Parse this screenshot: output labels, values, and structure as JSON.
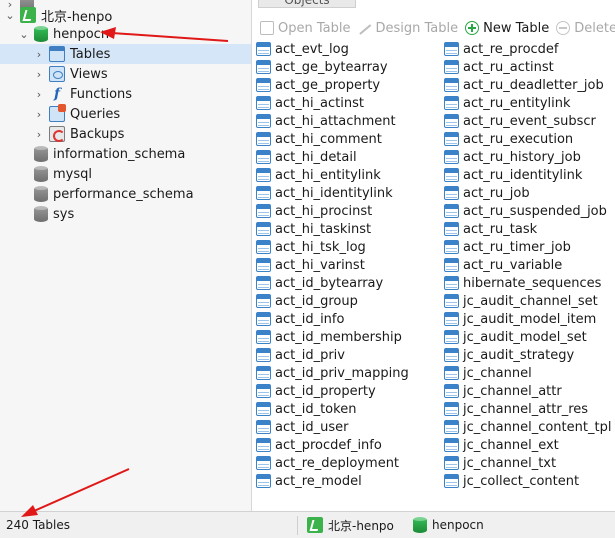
{
  "sidebar": {
    "connection": "北京-henpo",
    "database": "henpocn",
    "categories": {
      "tables": "Tables",
      "views": "Views",
      "functions": "Functions",
      "queries": "Queries",
      "backups": "Backups"
    },
    "other_databases": [
      "information_schema",
      "mysql",
      "performance_schema",
      "sys"
    ]
  },
  "objects_tab": "Objects",
  "toolbar": {
    "open_table": "Open Table",
    "design_table": "Design Table",
    "new_table": "New Table",
    "delete": "Delete"
  },
  "tables": {
    "left": [
      "act_evt_log",
      "act_ge_bytearray",
      "act_ge_property",
      "act_hi_actinst",
      "act_hi_attachment",
      "act_hi_comment",
      "act_hi_detail",
      "act_hi_entitylink",
      "act_hi_identitylink",
      "act_hi_procinst",
      "act_hi_taskinst",
      "act_hi_tsk_log",
      "act_hi_varinst",
      "act_id_bytearray",
      "act_id_group",
      "act_id_info",
      "act_id_membership",
      "act_id_priv",
      "act_id_priv_mapping",
      "act_id_property",
      "act_id_token",
      "act_id_user",
      "act_procdef_info",
      "act_re_deployment",
      "act_re_model"
    ],
    "right": [
      "act_re_procdef",
      "act_ru_actinst",
      "act_ru_deadletter_job",
      "act_ru_entitylink",
      "act_ru_event_subscr",
      "act_ru_execution",
      "act_ru_history_job",
      "act_ru_identitylink",
      "act_ru_job",
      "act_ru_suspended_job",
      "act_ru_task",
      "act_ru_timer_job",
      "act_ru_variable",
      "hibernate_sequences",
      "jc_audit_channel_set",
      "jc_audit_model_item",
      "jc_audit_model_set",
      "jc_audit_strategy",
      "jc_channel",
      "jc_channel_attr",
      "jc_channel_attr_res",
      "jc_channel_content_tpl",
      "jc_channel_ext",
      "jc_channel_txt",
      "jc_collect_content"
    ]
  },
  "status": {
    "count": "240 Tables",
    "connection": "北京-henpo",
    "database": "henpocn"
  },
  "colors": {
    "selection": "#d4e6f8",
    "annotation_arrow": "#e01818",
    "new_table_icon": "#28a745"
  }
}
